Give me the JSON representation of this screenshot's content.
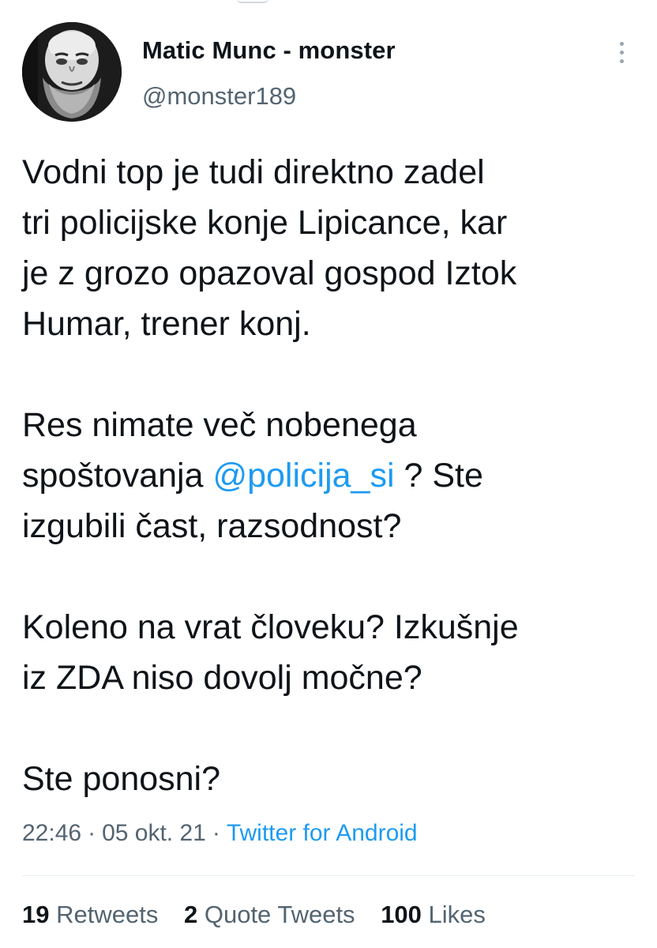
{
  "tweet": {
    "author": {
      "name": "Matic Munc - monster",
      "handle": "@monster189"
    },
    "paragraphs": [
      {
        "lines": [
          "Vodni top je tudi direktno zadel",
          "tri policijske konje Lipicance, kar",
          "je z grozo opazoval gospod Iztok",
          "Humar, trener konj."
        ]
      },
      {
        "line1": "Res nimate več nobenega",
        "line2_before": "spoštovanja ",
        "mention": "@policija_si",
        "line2_after": " ? Ste",
        "line3": "izgubili čast, razsodnost?"
      },
      {
        "lines": [
          "Koleno na vrat človeku? Izkušnje",
          "iz ZDA niso dovolj močne?"
        ]
      },
      {
        "lines": [
          "Ste ponosni?"
        ]
      }
    ],
    "time": "22:46",
    "separator": "·",
    "date": "05 okt. 21",
    "source": "Twitter for Android",
    "stats": {
      "retweets": {
        "count": "19",
        "label": "Retweets"
      },
      "quote_tweets": {
        "count": "2",
        "label": "Quote Tweets"
      },
      "likes": {
        "count": "100",
        "label": "Likes"
      }
    }
  },
  "colors": {
    "text": "#0f1419",
    "secondary": "#536471",
    "link": "#1d9bf0",
    "divider": "#e6ecf0"
  },
  "icons": {
    "more": "more-vertical-icon"
  }
}
